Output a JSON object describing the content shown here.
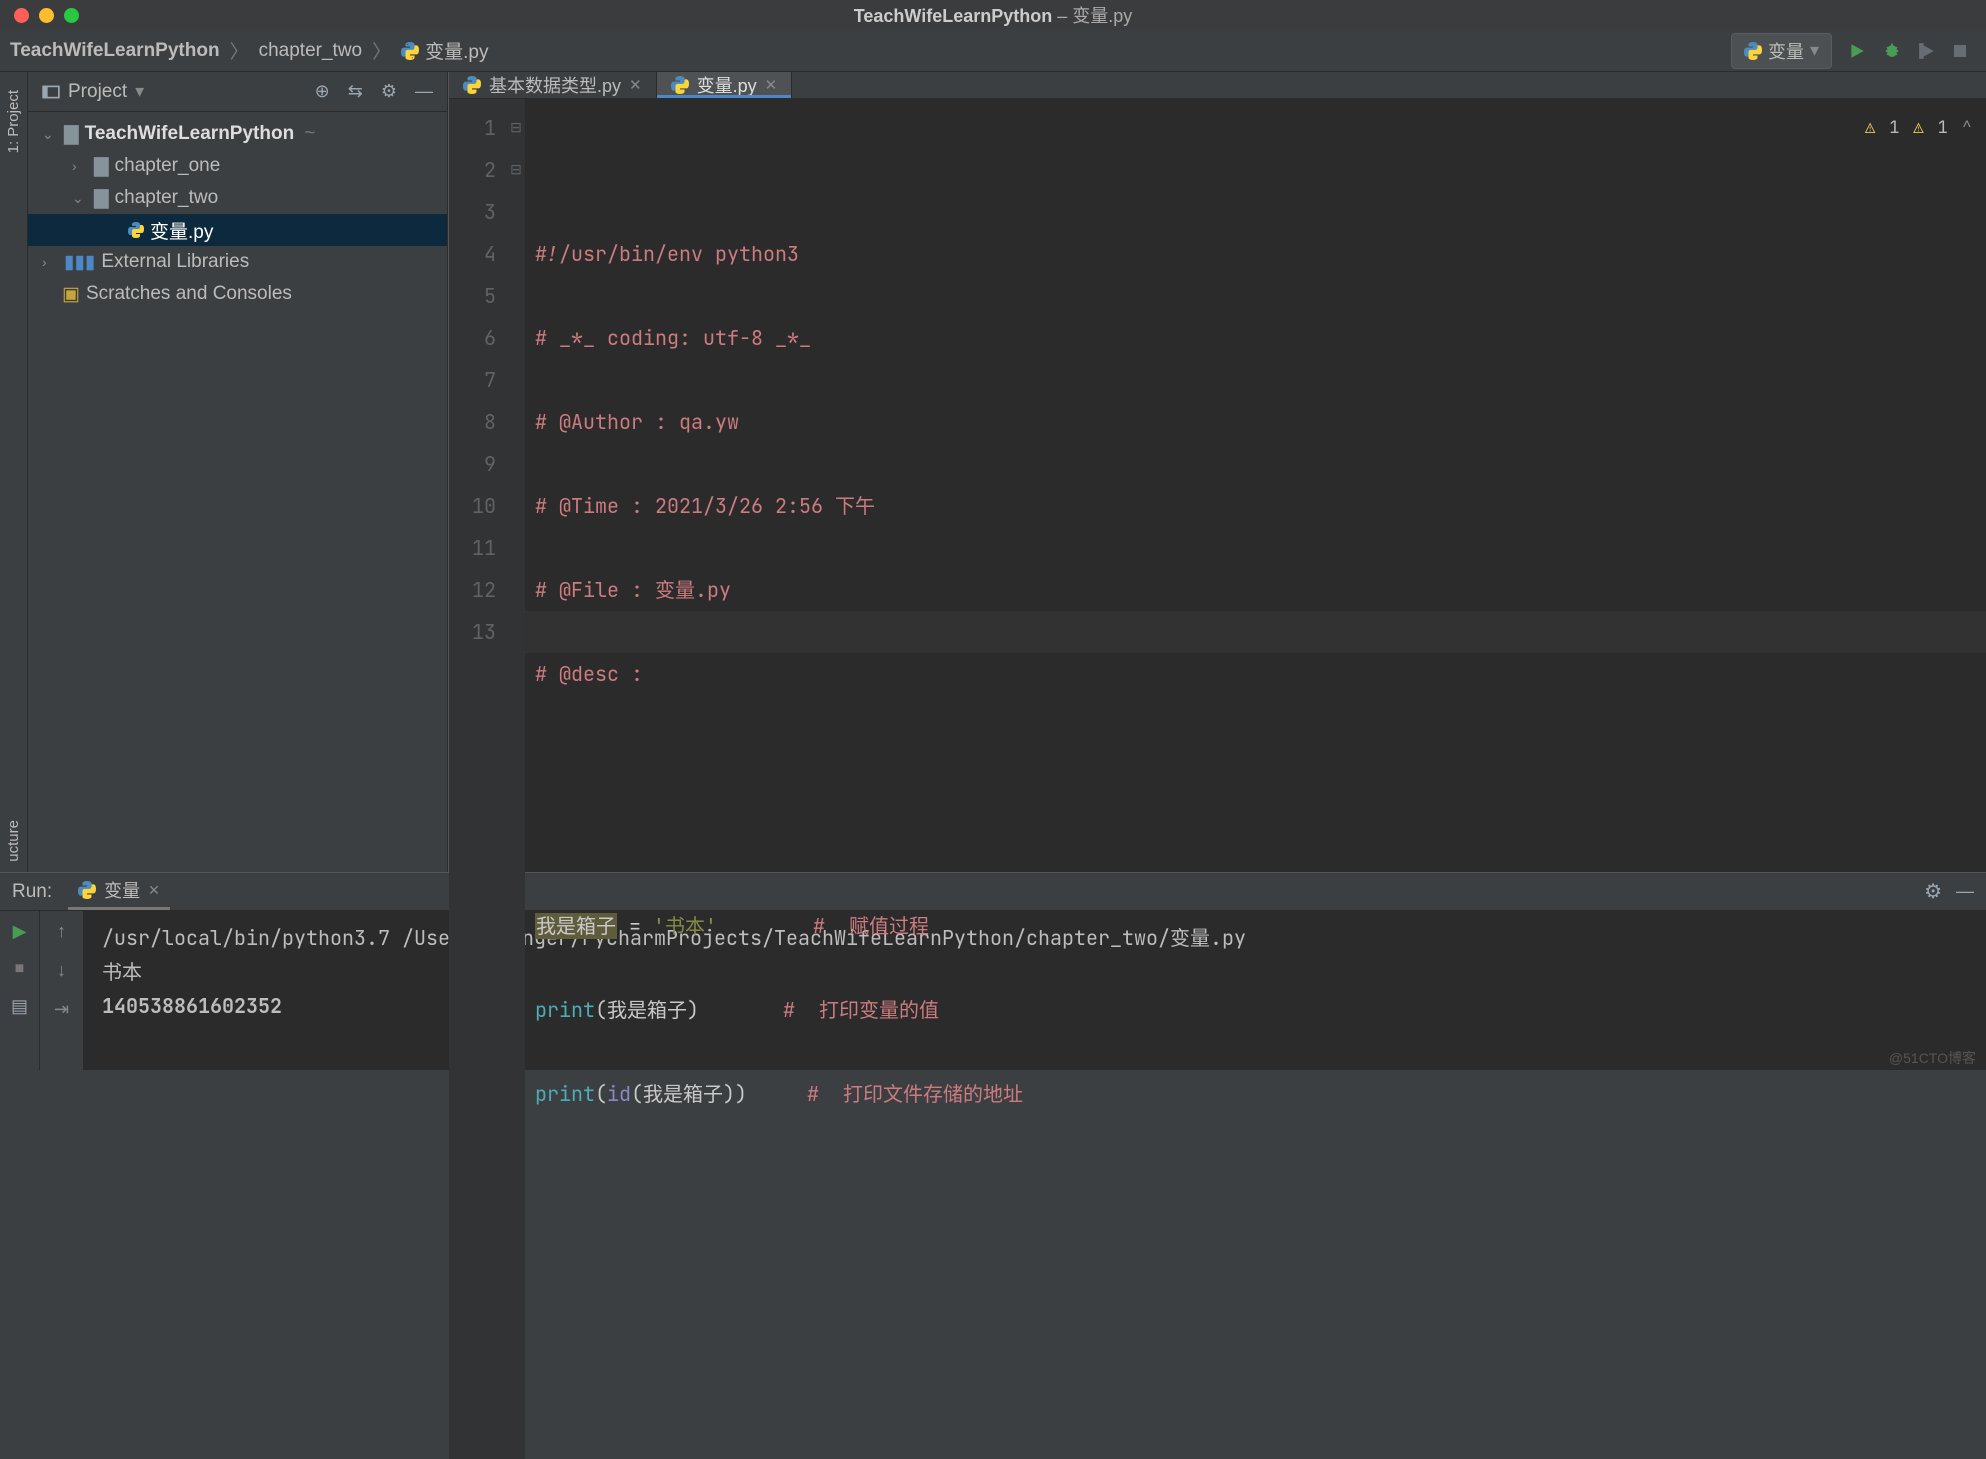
{
  "window": {
    "project": "TeachWifeLearnPython",
    "file": "变量.py",
    "title_sep": " – "
  },
  "breadcrumb": {
    "root": "TeachWifeLearnPython",
    "folder": "chapter_two",
    "file": "变量.py"
  },
  "runConfig": {
    "label": "变量"
  },
  "sideTab": {
    "project": "1: Project",
    "structure": "ucture"
  },
  "projectPanel": {
    "title": "Project"
  },
  "tree": {
    "root": "TeachWifeLearnPython",
    "chapter_one": "chapter_one",
    "chapter_two": "chapter_two",
    "file": "变量.py",
    "ext_lib": "External Libraries",
    "scratches": "Scratches and Consoles"
  },
  "tabs": {
    "t0": "基本数据类型.py",
    "t1": "变量.py"
  },
  "code": {
    "lines": [
      "1",
      "2",
      "3",
      "4",
      "5",
      "6",
      "7",
      "8",
      "9",
      "10",
      "11",
      "12",
      "13"
    ],
    "l1": "#!/usr/bin/env python3",
    "l2": "# _*_ coding: utf-8 _*_",
    "l3": "# @Author : qa.yw",
    "l4": "# @Time : 2021/3/26 2:56 下午",
    "l5": "# @File : 变量.py",
    "l6": "# @desc :",
    "l9_var": "我是箱子",
    "l9_eq": " = ",
    "l9_str": "'书本'",
    "l9_pad": "        ",
    "l9_c": "#  赋值过程",
    "l10_fn": "print",
    "l10_arg": "我是箱子",
    "l10_pad": "       ",
    "l10_c": "#  打印变量的值",
    "l11_fn": "print",
    "l11_bi": "id",
    "l11_arg": "我是箱子",
    "l11_pad": "     ",
    "l11_c": "#  打印文件存储的地址"
  },
  "warnings": {
    "w1": "1",
    "w2": "1"
  },
  "run": {
    "title": "Run:",
    "tab": "变量",
    "cmd": "/usr/local/bin/python3.7 /Users/younger/PycharmProjects/TeachWifeLearnPython/chapter_two/变量.py",
    "out1": "书本",
    "out2": "140538861602352"
  },
  "watermark": "@51CTO博客"
}
